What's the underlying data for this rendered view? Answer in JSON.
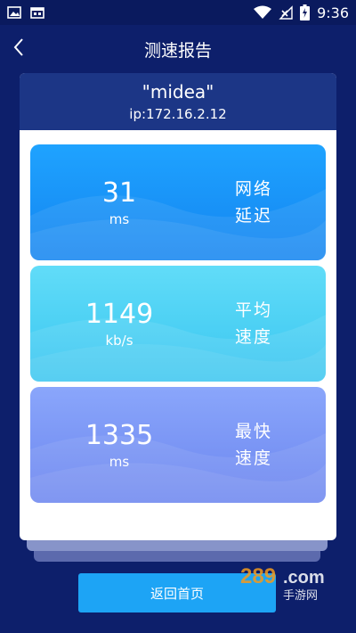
{
  "status_bar": {
    "time": "9:36",
    "left_icons": [
      "image-icon",
      "calendar-icon"
    ],
    "right_icons": [
      "wifi-icon",
      "no-sim-icon",
      "battery-charging-icon"
    ]
  },
  "header": {
    "title": "测速报告",
    "back_icon": "chevron-left-icon"
  },
  "report": {
    "device_name": "\"midea\"",
    "ip": "ip:172.16.2.12",
    "metrics": [
      {
        "value": "31",
        "unit": "ms",
        "label_line1": "网络",
        "label_line2": "延迟",
        "color": "#1a97fa"
      },
      {
        "value": "1149",
        "unit": "kb/s",
        "label_line1": "平均",
        "label_line2": "速度",
        "color": "#4ed2f4"
      },
      {
        "value": "1335",
        "unit": "ms",
        "label_line1": "最快",
        "label_line2": "速度",
        "color": "#7b96f5"
      }
    ]
  },
  "footer": {
    "home_button": "返回首页"
  },
  "watermark": {
    "logo_text": "289.com",
    "sub_text": "手游网"
  },
  "colors": {
    "background": "#0d1f6b",
    "card_header": "#1c3686",
    "button": "#1da4f5"
  }
}
